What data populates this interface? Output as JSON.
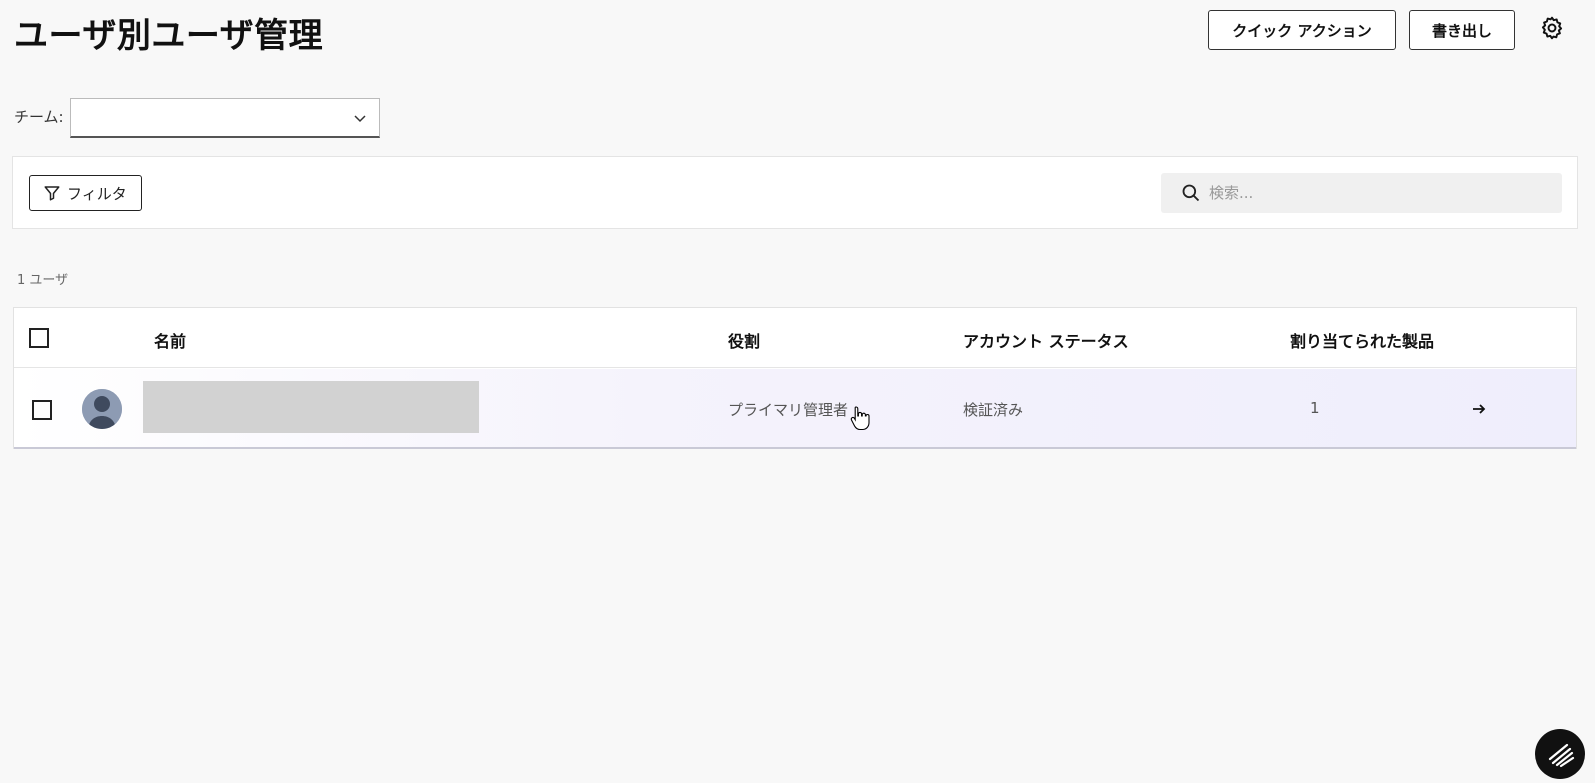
{
  "header": {
    "title": "ユーザ別ユーザ管理",
    "quick_action_label": "クイック アクション",
    "export_label": "書き出し",
    "settings_icon": "gear-icon"
  },
  "team_filter": {
    "label": "チーム:",
    "selected_value": ""
  },
  "toolbar": {
    "filter_label": "フィルタ",
    "search_placeholder": "検索..."
  },
  "summary": {
    "user_count": "1 ユーザ"
  },
  "table": {
    "columns": [
      "名前",
      "役割",
      "アカウント ステータス",
      "割り当てられた製品"
    ],
    "rows": [
      {
        "name": "",
        "role": "プライマリ管理者",
        "status": "検証済み",
        "products": "1"
      }
    ]
  }
}
